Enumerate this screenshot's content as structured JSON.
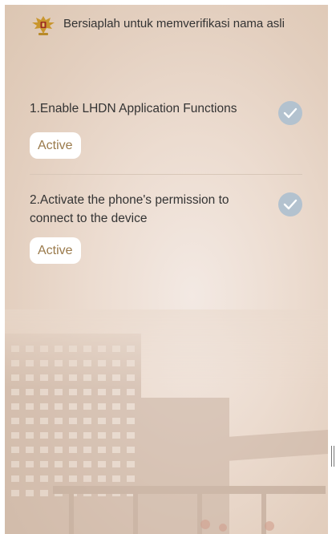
{
  "header": {
    "title": "Bersiaplah untuk memverifikasi nama asli",
    "emblem_icon": "garuda-emblem-icon"
  },
  "steps": [
    {
      "title": "1.Enable LHDN Application Functions",
      "status_icon": "check-circle-icon",
      "button_label": "Active"
    },
    {
      "title": "2.Activate the phone's permission to connect to the device",
      "status_icon": "check-circle-icon",
      "button_label": "Active"
    }
  ],
  "colors": {
    "check_circle": "#b3c2cf",
    "button_text": "#9a7a4b",
    "button_bg": "#ffffff"
  }
}
